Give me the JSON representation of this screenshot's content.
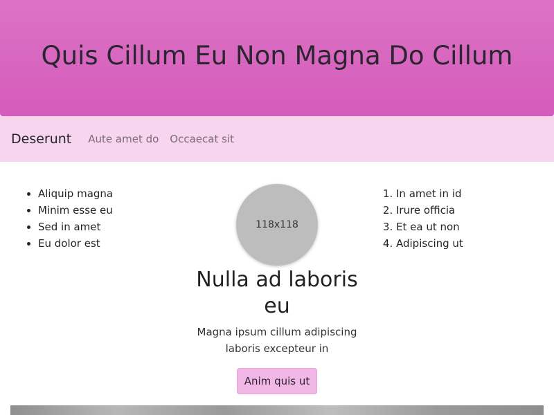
{
  "header": {
    "title": "Quis Cillum Eu Non Magna Do Cillum"
  },
  "navbar": {
    "brand": "Deserunt",
    "links": [
      "Aute amet do",
      "Occaecat sit"
    ]
  },
  "left_list": [
    "Aliquip magna",
    "Minim esse eu",
    "Sed in amet",
    "Eu dolor est"
  ],
  "right_list": [
    "In amet in id",
    "Irure officia",
    "Et ea ut non",
    "Adipiscing ut"
  ],
  "card": {
    "image_label": "118x118",
    "title": "Nulla ad laboris eu",
    "text": "Magna ipsum cillum adipiscing laboris excepteur in",
    "button": "Anim quis ut"
  },
  "colors": {
    "header": "#d865c0",
    "navbar": "#f7d5ee",
    "button": "#f1b8e6"
  }
}
